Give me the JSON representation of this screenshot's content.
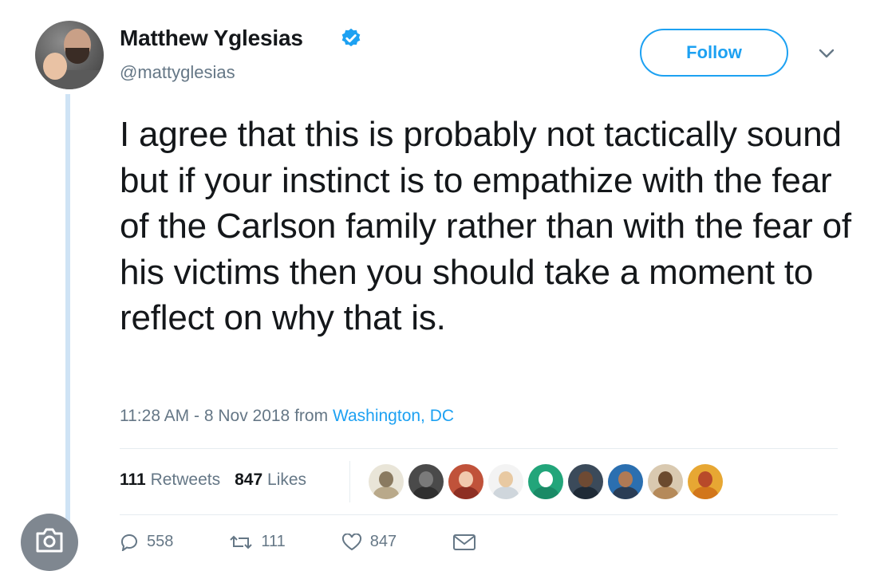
{
  "tweet": {
    "author_name": "Matthew Yglesias",
    "handle": "@mattyglesias",
    "follow_label": "Follow",
    "text": "I agree that this is probably not tactically sound but if your instinct is to empathize with the fear of the Carlson family rather than with the fear of his victims then you should take a moment to reflect on why that is.",
    "timestamp": "11:28 AM - 8 Nov 2018",
    "from_label": "from",
    "location": "Washington, DC",
    "retweets_count": "111",
    "retweets_label": "Retweets",
    "likes_count": "847",
    "likes_label": "Likes",
    "actions": {
      "replies": "558",
      "retweets": "111",
      "likes": "847"
    }
  },
  "icons": {
    "verified": "verified-badge-icon",
    "chevron": "chevron-down-icon",
    "reply": "reply-icon",
    "retweet": "retweet-icon",
    "like": "heart-icon",
    "dm": "envelope-icon",
    "overlay": "camera-icon"
  },
  "colors": {
    "accent": "#1da1f2",
    "muted": "#657786",
    "text": "#14171a"
  },
  "likers": [
    {
      "bg": "#e9e5d8",
      "head": "#8a7a60",
      "body": "#b9a98a"
    },
    {
      "bg": "#4a4a4a",
      "head": "#7a7a7a",
      "body": "#2f2f2f"
    },
    {
      "bg": "#c0523a",
      "head": "#f1c9ae",
      "body": "#8e2f23"
    },
    {
      "bg": "#f3f3f3",
      "head": "#e8c9a2",
      "body": "#cfd6dc"
    },
    {
      "bg": "#22a57a",
      "head": "#ffffff",
      "body": "#1a8a66"
    },
    {
      "bg": "#3b4a5a",
      "head": "#6e4a33",
      "body": "#1f2a36"
    },
    {
      "bg": "#2b6fb0",
      "head": "#b07a55",
      "body": "#2a3d55"
    },
    {
      "bg": "#d9c9b0",
      "head": "#6b4a2e",
      "body": "#b58a5a"
    },
    {
      "bg": "#e7a733",
      "head": "#b84a2a",
      "body": "#d2761b"
    }
  ]
}
